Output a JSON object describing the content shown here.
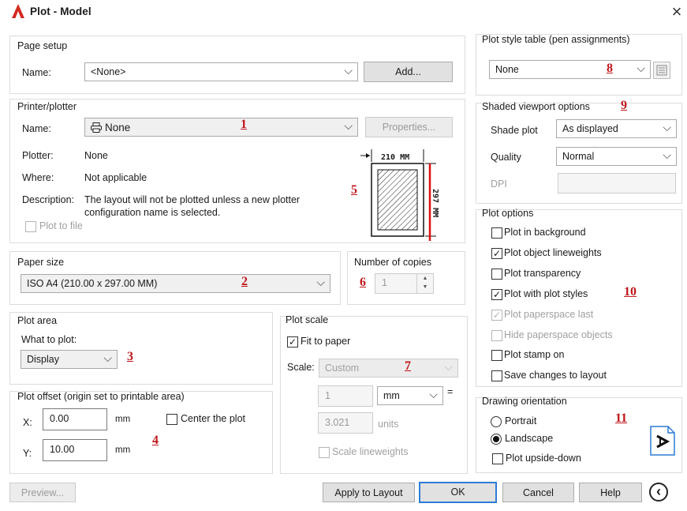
{
  "window": {
    "title": "Plot - Model",
    "close_glyph": "×"
  },
  "page_setup": {
    "title": "Page setup",
    "name_label": "Name:",
    "name_value": "<None>",
    "add_button": "Add..."
  },
  "printer": {
    "title": "Printer/plotter",
    "name_label": "Name:",
    "name_value": "None",
    "properties_button": "Properties...",
    "plotter_label": "Plotter:",
    "plotter_value": "None",
    "where_label": "Where:",
    "where_value": "Not applicable",
    "description_label": "Description:",
    "description_line1": "The layout will not be plotted unless a new plotter",
    "description_line2": "configuration name is selected.",
    "plot_to_file": "Plot to file"
  },
  "preview": {
    "width_text": "210 MM",
    "height_text": "297 MM"
  },
  "paper_size": {
    "title": "Paper size",
    "value": "ISO A4 (210.00 x 297.00 MM)"
  },
  "copies": {
    "title": "Number of copies",
    "value": "1"
  },
  "plot_area": {
    "title": "Plot area",
    "what_label": "What to plot:",
    "value": "Display"
  },
  "plot_offset": {
    "title": "Plot offset (origin set to printable area)",
    "x_label": "X:",
    "x_value": "0.00",
    "y_label": "Y:",
    "y_value": "10.00",
    "unit": "mm",
    "center_label": "Center the plot"
  },
  "plot_scale": {
    "title": "Plot scale",
    "fit_label": "Fit to paper",
    "scale_label": "Scale:",
    "scale_value": "Custom",
    "value1": "1",
    "unit1": "mm",
    "equals": "=",
    "value2": "3.021",
    "unit2": "units",
    "lineweights_label": "Scale lineweights"
  },
  "pen": {
    "title": "Plot style table (pen assignments)",
    "value": "None"
  },
  "shaded": {
    "title": "Shaded viewport options",
    "shade_label": "Shade plot",
    "shade_value": "As displayed",
    "quality_label": "Quality",
    "quality_value": "Normal",
    "dpi_label": "DPI"
  },
  "options": {
    "title": "Plot options",
    "items": [
      {
        "label": "Plot in background",
        "checked": false,
        "disabled": false
      },
      {
        "label": "Plot object lineweights",
        "checked": true,
        "disabled": false
      },
      {
        "label": "Plot transparency",
        "checked": false,
        "disabled": false
      },
      {
        "label": "Plot with plot styles",
        "checked": true,
        "disabled": false
      },
      {
        "label": "Plot paperspace last",
        "checked": true,
        "disabled": true
      },
      {
        "label": "Hide paperspace objects",
        "checked": false,
        "disabled": true
      },
      {
        "label": "Plot stamp on",
        "checked": false,
        "disabled": false
      },
      {
        "label": "Save changes to layout",
        "checked": false,
        "disabled": false
      }
    ]
  },
  "orientation": {
    "title": "Drawing orientation",
    "portrait": "Portrait",
    "landscape": "Landscape",
    "upside_down": "Plot upside-down",
    "selected": "landscape",
    "icon_glyph": "A"
  },
  "footer": {
    "preview": "Preview...",
    "apply": "Apply to Layout",
    "ok": "OK",
    "cancel": "Cancel",
    "help": "Help",
    "expand_glyph": "‹"
  },
  "annotations": [
    "1",
    "2",
    "3",
    "4",
    "5",
    "6",
    "7",
    "8",
    "9",
    "10",
    "11"
  ],
  "colors": {
    "annotation": "#c0151b",
    "accent": "#2c7bd6",
    "logo": "#d42a1f"
  }
}
